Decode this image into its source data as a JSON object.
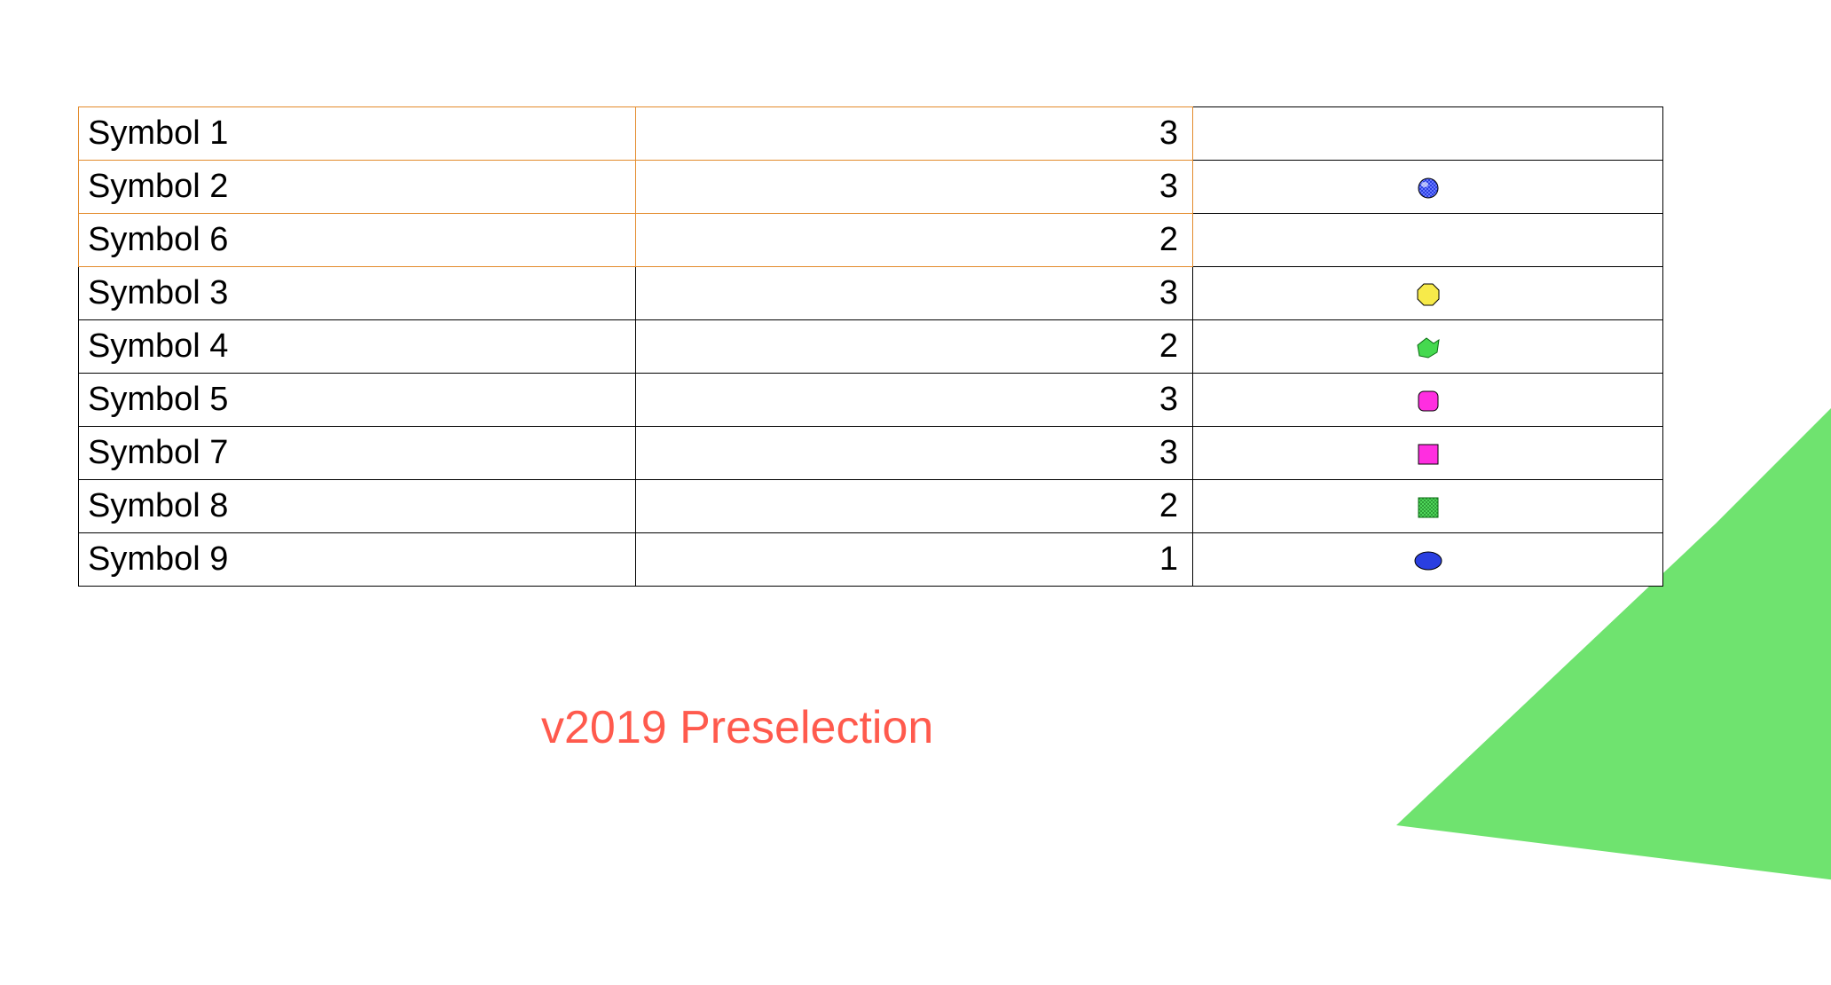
{
  "caption": "v2019 Preselection",
  "rows": [
    {
      "name": "Symbol 1",
      "count": "3",
      "icon": "",
      "selected": true
    },
    {
      "name": "Symbol 2",
      "count": "3",
      "icon": "sphere-blue",
      "selected": true
    },
    {
      "name": "Symbol 6",
      "count": "2",
      "icon": "",
      "selected": true
    },
    {
      "name": "Symbol 3",
      "count": "3",
      "icon": "octagon-yellow",
      "selected": false
    },
    {
      "name": "Symbol 4",
      "count": "2",
      "icon": "blob-green",
      "selected": false
    },
    {
      "name": "Symbol 5",
      "count": "3",
      "icon": "rounded-magenta",
      "selected": false
    },
    {
      "name": "Symbol 7",
      "count": "3",
      "icon": "square-magenta",
      "selected": false
    },
    {
      "name": "Symbol 8",
      "count": "2",
      "icon": "square-green-pattern",
      "selected": false
    },
    {
      "name": "Symbol 9",
      "count": "1",
      "icon": "ellipse-blue",
      "selected": false
    }
  ],
  "colors": {
    "selection_border": "#e38b2c",
    "caption": "#ff5a4d",
    "decor_shape_fill": "#6fe36f"
  }
}
